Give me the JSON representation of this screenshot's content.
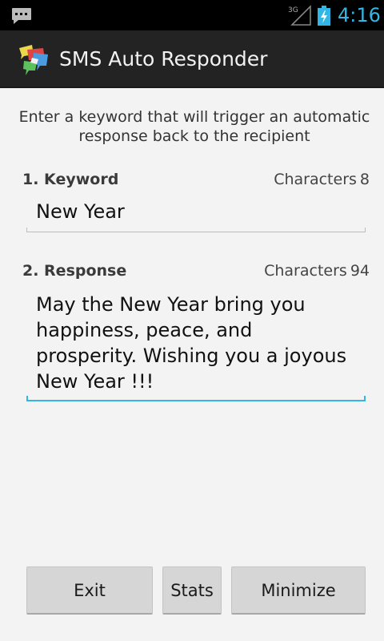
{
  "status_bar": {
    "time": "4:16",
    "network": "3G",
    "icons": [
      "message-notification-icon",
      "signal-icon",
      "battery-charging-icon"
    ],
    "time_color": "#33b5e5"
  },
  "action_bar": {
    "title": "SMS Auto Responder",
    "icon": "app-chat-bubbles-icon"
  },
  "content": {
    "instructions": "Enter a keyword that will trigger an automatic response back to the recipient",
    "keyword": {
      "label": "1. Keyword",
      "count_label": "Characters",
      "count": "8",
      "value": "New Year"
    },
    "response": {
      "label": "2. Response",
      "count_label": "Characters",
      "count": "94",
      "value": "May the New Year bring you happiness, peace, and prosperity. Wishing you a joyous New Year !!!"
    }
  },
  "buttons": {
    "exit": "Exit",
    "stats": "Stats",
    "minimize": "Minimize"
  },
  "colors": {
    "accent": "#33b5e5",
    "action_bar": "#232323",
    "background": "#f3f3f3"
  }
}
